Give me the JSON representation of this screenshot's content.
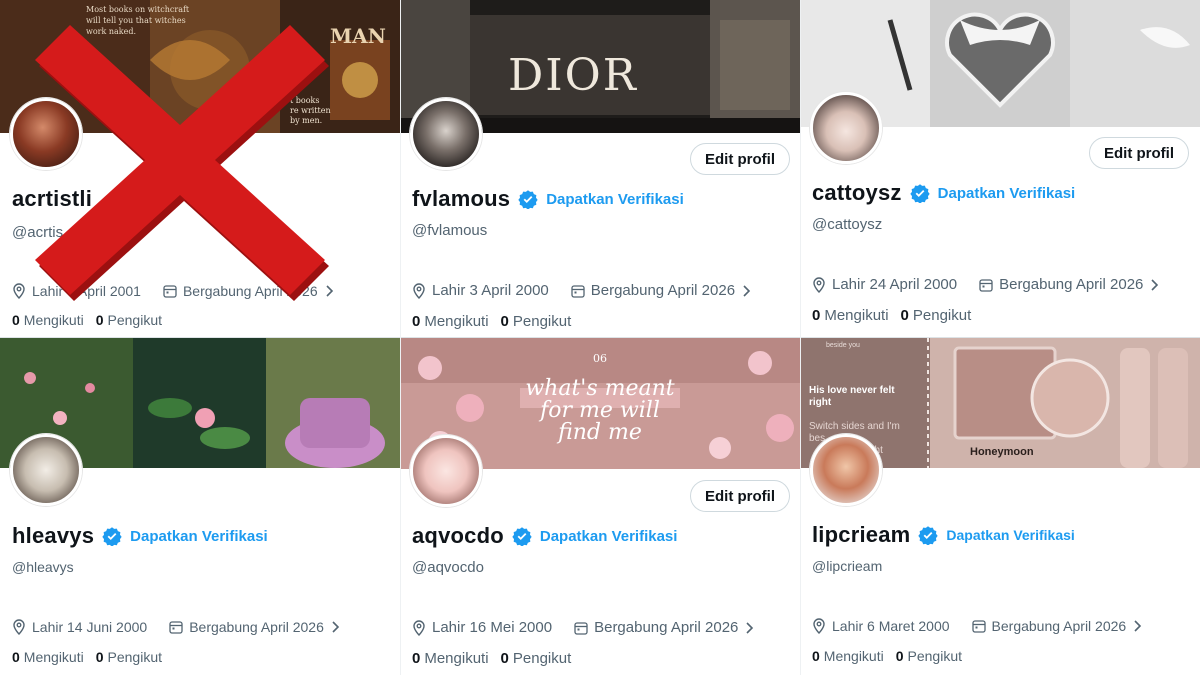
{
  "profiles": [
    {
      "display_name": "acrtistli",
      "handle": "@acrtis",
      "birth": "Lahir 9 April 2001",
      "joined": "Bergabung April 2026",
      "following_count": "0",
      "following_label": "Mengikuti",
      "followers_count": "0",
      "followers_label": "Pengikut",
      "banner_lines": [
        "Most books on witchcraft",
        "will tell you that witches",
        "work naked.",
        "MAN",
        "t books",
        "re written",
        "by men."
      ],
      "rejected": true
    },
    {
      "display_name": "fvlamous",
      "verify_label": "Dapatkan Verifikasi",
      "handle": "@fvlamous",
      "birth": "Lahir 3 April 2000",
      "joined": "Bergabung April 2026",
      "following_count": "0",
      "following_label": "Mengikuti",
      "followers_count": "0",
      "followers_label": "Pengikut",
      "edit_label": "Edit profil",
      "banner_sign": "DIOR"
    },
    {
      "display_name": "cattoysz",
      "verify_label": "Dapatkan Verifikasi",
      "handle": "@cattoysz",
      "birth": "Lahir 24 April 2000",
      "joined": "Bergabung April 2026",
      "following_count": "0",
      "following_label": "Mengikuti",
      "followers_count": "0",
      "followers_label": "Pengikut",
      "edit_label": "Edit profil"
    },
    {
      "display_name": "hleavys",
      "verify_label": "Dapatkan Verifikasi",
      "handle": "@hleavys",
      "birth": "Lahir 14 Juni 2000",
      "joined": "Bergabung April 2026",
      "following_count": "0",
      "following_label": "Mengikuti",
      "followers_count": "0",
      "followers_label": "Pengikut"
    },
    {
      "display_name": "aqvocdo",
      "verify_label": "Dapatkan Verifikasi",
      "handle": "@aqvocdo",
      "birth": "Lahir 16 Mei 2000",
      "joined": "Bergabung April 2026",
      "following_count": "0",
      "following_label": "Mengikuti",
      "followers_count": "0",
      "followers_label": "Pengikut",
      "edit_label": "Edit profil",
      "banner_lines": [
        "what's meant",
        "for me will",
        "find me"
      ],
      "banner_number": "06"
    },
    {
      "display_name": "lipcrieam",
      "verify_label": "Dapatkan Verifikasi",
      "handle": "@lipcrieam",
      "birth": "Lahir 6 Maret 2000",
      "joined": "Bergabung April 2026",
      "following_count": "0",
      "following_label": "Mengikuti",
      "followers_count": "0",
      "followers_label": "Pengikut",
      "banner_lines": [
        "beside you",
        "His love never felt",
        "right",
        "Switch sides and I'm",
        "bes",
        "ght"
      ],
      "banner_product": "Honeymoon"
    }
  ],
  "colors": {
    "verified_blue": "#1d9bf0",
    "secondary_text": "#536471",
    "primary_text": "#0f1419",
    "reject_red": "#d51b1b"
  },
  "icons": {
    "verified": "verified-badge-icon",
    "location": "location-pin-icon",
    "calendar": "calendar-icon",
    "chevron": "chevron-right-icon",
    "reject": "red-x-mark-icon"
  }
}
